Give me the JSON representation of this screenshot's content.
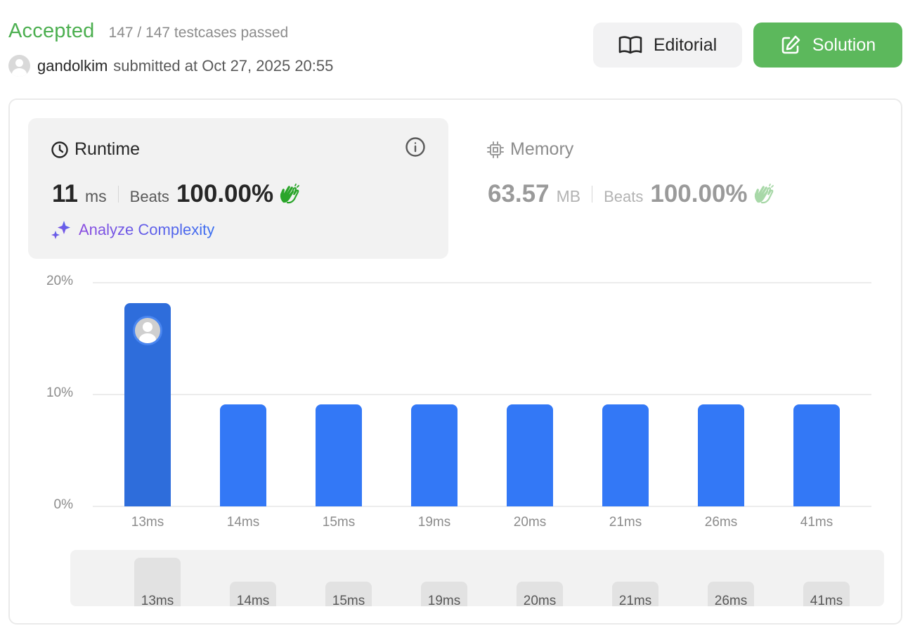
{
  "header": {
    "status": "Accepted",
    "testcases": "147 / 147 testcases passed",
    "username": "gandolkim",
    "submitted": "submitted at Oct 27, 2025 20:55",
    "editorial_label": "Editorial",
    "solution_label": "Solution"
  },
  "runtime": {
    "title": "Runtime",
    "value": "11",
    "unit": "ms",
    "beats_label": "Beats",
    "beats_value": "100.00%",
    "analyze_label": "Analyze Complexity"
  },
  "memory": {
    "title": "Memory",
    "value": "63.57",
    "unit": "MB",
    "beats_label": "Beats",
    "beats_value": "100.00%"
  },
  "colors": {
    "accepted": "#4caf50",
    "bar": "#3378f6",
    "bar_selected": "#2e6ddb",
    "solution_button": "#5cb85c"
  },
  "chart_data": {
    "type": "bar",
    "categories": [
      "13ms",
      "14ms",
      "15ms",
      "19ms",
      "20ms",
      "21ms",
      "26ms",
      "41ms"
    ],
    "values": [
      18.2,
      9.1,
      9.1,
      9.1,
      9.1,
      9.1,
      9.1,
      9.1
    ],
    "ylim": [
      0,
      20
    ],
    "yticks": [
      "0%",
      "10%",
      "20%"
    ],
    "highlight_index": 0,
    "grid": true
  }
}
